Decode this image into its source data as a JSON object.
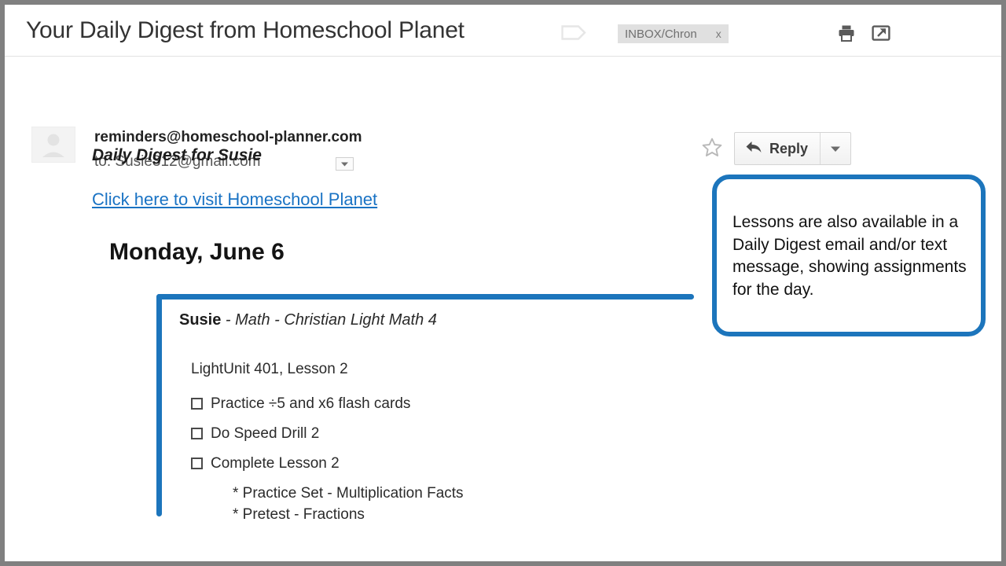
{
  "header": {
    "subject": "Your Daily Digest from Homeschool Planet",
    "tag_icon": "label-tag-icon",
    "label_chip": {
      "text": "INBOX/Chron",
      "remove": "x"
    },
    "print_icon": "printer-icon",
    "popout_icon": "open-in-new-window-icon"
  },
  "message": {
    "avatar_icon": "avatar-person-icon",
    "from": "reminders@homeschool-planner.com",
    "to": "to: Susie312@gmail.com",
    "recipient_caret_icon": "chevron-down-icon",
    "star_icon": "star-outline-icon",
    "reply_label": "Reply",
    "reply_icon": "reply-arrow-icon",
    "reply_more_icon": "chevron-down-icon"
  },
  "body": {
    "digest_title": "Daily Digest for Susie",
    "link": "Click here to visit Homeschool Planet",
    "day_heading": "Monday, June 6",
    "assignment": {
      "student": "Susie",
      "course": " - Math - Christian Light Math 4",
      "subtitle": "LightUnit 401, Lesson 2",
      "tasks": [
        {
          "label": "Practice ÷5 and x6 flash cards",
          "checked": false
        },
        {
          "label": "Do Speed Drill 2",
          "checked": false
        },
        {
          "label": "Complete Lesson 2",
          "checked": false
        }
      ],
      "subtasks": [
        "* Practice Set - Multiplication Facts",
        "* Pretest - Fractions"
      ]
    }
  },
  "annotation": {
    "text": "Lessons are also available in a Daily Digest email and/or text message, showing assignments for the day."
  },
  "colors": {
    "accent_blue": "#1c75bc",
    "link_blue": "#1a73c4",
    "frame_gray": "#808080",
    "chip_gray": "#e0e0e0"
  }
}
